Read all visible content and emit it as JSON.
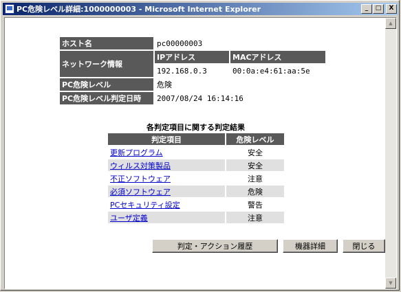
{
  "window": {
    "title": "PC危険レベル詳細:1000000003 - Microsoft Internet Explorer"
  },
  "titlebar_buttons": {
    "minimize": "_",
    "maximize": "□",
    "close": "X"
  },
  "scrollbar": {
    "up": "▲",
    "down": "▼"
  },
  "info": {
    "host_label": "ホスト名",
    "host_value": "pc00000003",
    "network_label": "ネットワーク情報",
    "ip_label": "IPアドレス",
    "mac_label": "MACアドレス",
    "ip_value": "192.168.0.3",
    "mac_value": "00:0a:e4:61:aa:5e",
    "risk_label": "PC危険レベル",
    "risk_value": "危険",
    "date_label": "PC危険レベル判定日時",
    "date_value": "2007/08/24 16:14:16"
  },
  "results": {
    "title": "各判定項目に関する判定結果",
    "headers": [
      "判定項目",
      "危険レベル"
    ],
    "rows": [
      {
        "item": "更新プログラム",
        "level": "安全"
      },
      {
        "item": "ウィルス対策製品",
        "level": "安全"
      },
      {
        "item": "不正ソフトウェア",
        "level": "注意"
      },
      {
        "item": "必須ソフトウェア",
        "level": "危険"
      },
      {
        "item": "PCセキュリティ設定",
        "level": "警告"
      },
      {
        "item": "ユーザ定義",
        "level": "注意"
      }
    ]
  },
  "buttons": {
    "history": "判定・アクション履歴",
    "device": "機器詳細",
    "close": "閉じる"
  }
}
